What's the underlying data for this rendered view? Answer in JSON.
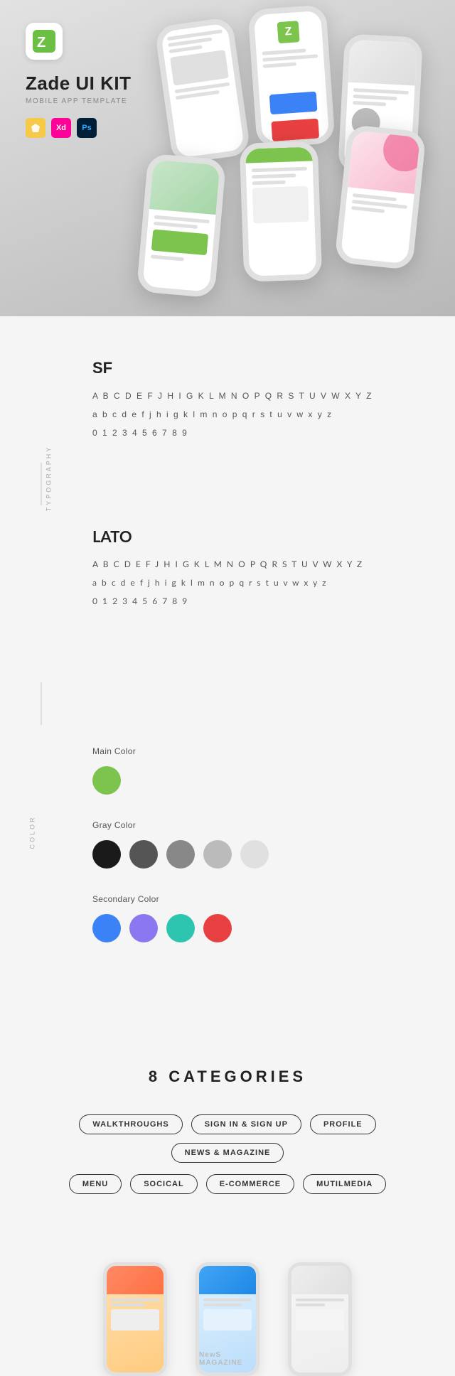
{
  "hero": {
    "logo_letter": "Z",
    "title": "Zade UI KIT",
    "subtitle": "MOBILE APP TEMPLATE",
    "tools": [
      {
        "name": "Sketch",
        "label": "S",
        "class": "tool-sketch"
      },
      {
        "name": "Adobe XD",
        "label": "X",
        "class": "tool-xd"
      },
      {
        "name": "Photoshop",
        "label": "P",
        "class": "tool-ps"
      }
    ]
  },
  "typography": {
    "section_label": "TYPOGRAPHY",
    "fonts": [
      {
        "name": "SF",
        "uppercase": "A B C D E F J H I G K L M N O P Q R S T U V W X Y Z",
        "lowercase": "a b c d e f j h i g k l m n o p q r s t u v w x y z",
        "numbers": "0 1 2 3 4 5 6 7 8 9",
        "class": ""
      },
      {
        "name": "LATO",
        "uppercase": "A B C D E F J H I G K L M N O P Q R S T U V W X Y Z",
        "lowercase": "a b c d e f j h i g k l m n o p q r s t u v w x y z",
        "numbers": "0 1 2 3 4 5 6 7 8 9",
        "class": "lato-font"
      }
    ]
  },
  "colors": {
    "section_label": "COLOR",
    "groups": [
      {
        "label": "Main Color",
        "swatches": [
          {
            "color": "#7cc44d",
            "name": "green-main"
          }
        ]
      },
      {
        "label": "Gray Color",
        "swatches": [
          {
            "color": "#1a1a1a",
            "name": "gray-1"
          },
          {
            "color": "#555555",
            "name": "gray-2"
          },
          {
            "color": "#888888",
            "name": "gray-3"
          },
          {
            "color": "#bbbbbb",
            "name": "gray-4"
          },
          {
            "color": "#e0e0e0",
            "name": "gray-5"
          }
        ]
      },
      {
        "label": "Secondary Color",
        "swatches": [
          {
            "color": "#3b82f6",
            "name": "blue"
          },
          {
            "color": "#8b78f0",
            "name": "purple"
          },
          {
            "color": "#2dc5b0",
            "name": "teal"
          },
          {
            "color": "#e84040",
            "name": "red"
          }
        ]
      }
    ]
  },
  "categories": {
    "title": "8 CATEGORIES",
    "tags": [
      "WALKTHROUGHS",
      "SIGN IN & SIGN UP",
      "PROFILE",
      "NEWS & MAGAZINE",
      "MENU",
      "SOCICAL",
      "E-COMMERCE",
      "MUTILMEDIA"
    ]
  },
  "preview": {
    "label": "NewS MAGAZINE"
  }
}
